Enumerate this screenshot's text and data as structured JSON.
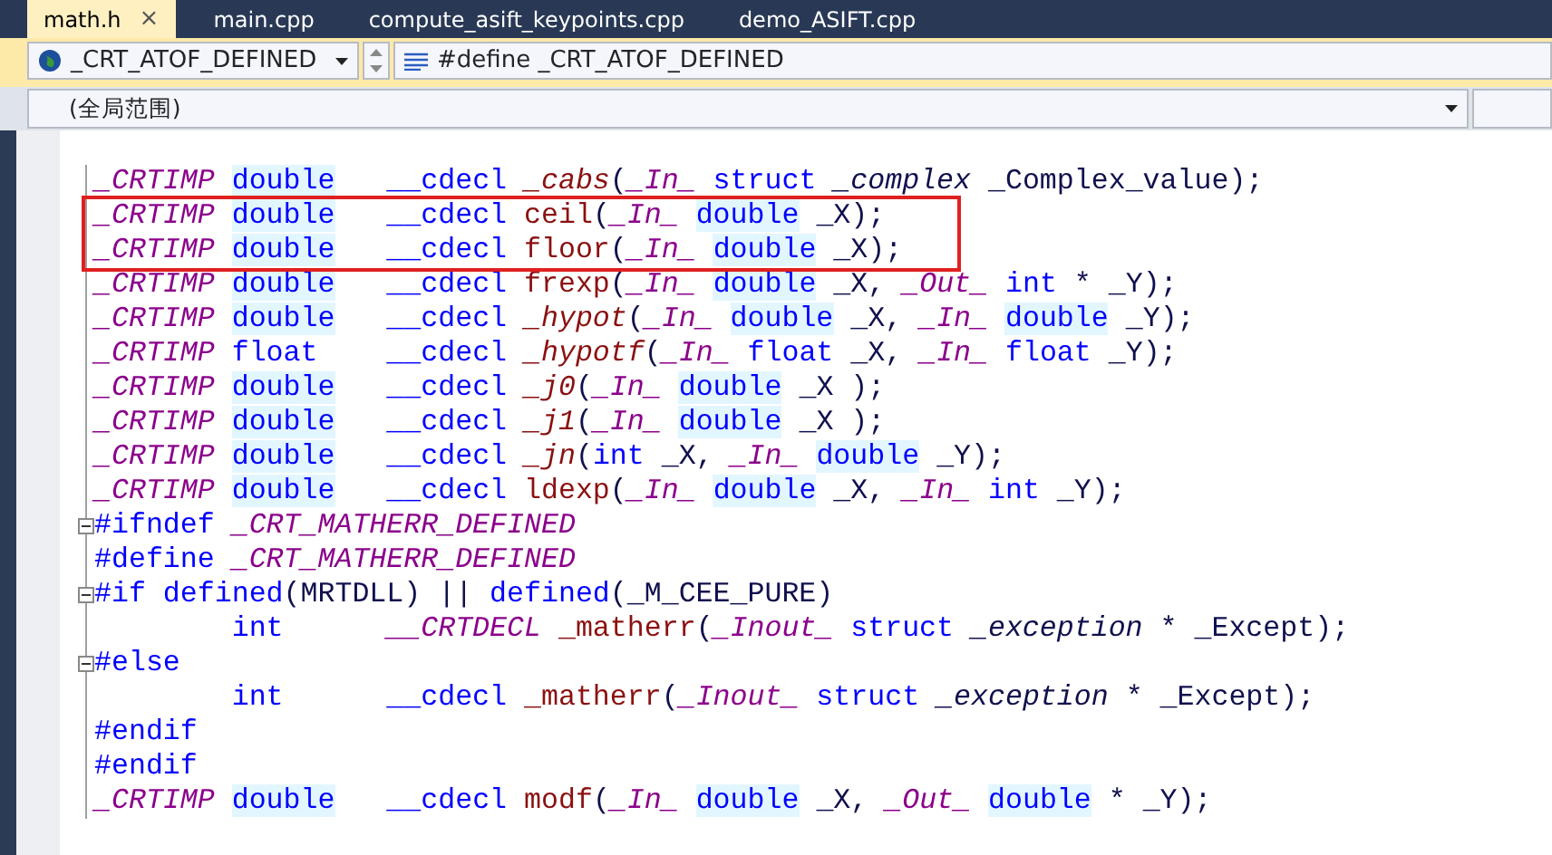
{
  "tabs": [
    {
      "label": "math.h",
      "selected": true,
      "close": "×"
    },
    {
      "label": "main.cpp",
      "selected": false
    },
    {
      "label": "compute_asift_keypoints.cpp",
      "selected": false
    },
    {
      "label": "demo_ASIFT.cpp",
      "selected": false
    }
  ],
  "navigation": {
    "type_combo": {
      "value": "_CRT_ATOF_DEFINED"
    },
    "member_combo": {
      "value": "#define _CRT_ATOF_DEFINED"
    },
    "scope_combo": {
      "value": "(全局范围)"
    }
  },
  "editor": {
    "lines": [
      {
        "tokens": [
          {
            "kind": "sal",
            "text": "_CRTIMP "
          },
          {
            "kind": "type",
            "text": "double"
          },
          {
            "kind": "kw",
            "text": "   __cdecl"
          },
          {
            "kind": "fnit",
            "text": " _cabs"
          },
          {
            "kind": "plain",
            "text": "("
          },
          {
            "kind": "sal",
            "text": "_In_"
          },
          {
            "kind": "kw",
            "text": " struct"
          },
          {
            "kind": "it",
            "text": " _complex"
          },
          {
            "kind": "plain",
            "text": " _Complex_value);"
          }
        ]
      },
      {
        "boxed": true,
        "tokens": [
          {
            "kind": "sal",
            "text": "_CRTIMP "
          },
          {
            "kind": "type",
            "text": "double"
          },
          {
            "kind": "kw",
            "text": "   __cdecl"
          },
          {
            "kind": "fn",
            "text": " ceil"
          },
          {
            "kind": "plain",
            "text": "("
          },
          {
            "kind": "sal",
            "text": "_In_ "
          },
          {
            "kind": "type",
            "text": "double"
          },
          {
            "kind": "plain",
            "text": " _X);"
          }
        ]
      },
      {
        "boxed": true,
        "tokens": [
          {
            "kind": "sal",
            "text": "_CRTIMP "
          },
          {
            "kind": "type",
            "text": "double"
          },
          {
            "kind": "kw",
            "text": "   __cdecl"
          },
          {
            "kind": "fn",
            "text": " floor"
          },
          {
            "kind": "plain",
            "text": "("
          },
          {
            "kind": "sal",
            "text": "_In_ "
          },
          {
            "kind": "type",
            "text": "double"
          },
          {
            "kind": "plain",
            "text": " _X);"
          }
        ]
      },
      {
        "tokens": [
          {
            "kind": "sal",
            "text": "_CRTIMP "
          },
          {
            "kind": "type",
            "text": "double"
          },
          {
            "kind": "kw",
            "text": "   __cdecl"
          },
          {
            "kind": "fn",
            "text": " frexp"
          },
          {
            "kind": "plain",
            "text": "("
          },
          {
            "kind": "sal",
            "text": "_In_ "
          },
          {
            "kind": "type",
            "text": "double"
          },
          {
            "kind": "plain",
            "text": " _X,"
          },
          {
            "kind": "sal",
            "text": " _Out_"
          },
          {
            "kind": "kw",
            "text": " int"
          },
          {
            "kind": "plain",
            "text": " * _Y);"
          }
        ]
      },
      {
        "tokens": [
          {
            "kind": "sal",
            "text": "_CRTIMP "
          },
          {
            "kind": "type",
            "text": "double"
          },
          {
            "kind": "kw",
            "text": "   __cdecl"
          },
          {
            "kind": "fnit",
            "text": " _hypot"
          },
          {
            "kind": "plain",
            "text": "("
          },
          {
            "kind": "sal",
            "text": "_In_ "
          },
          {
            "kind": "type",
            "text": "double"
          },
          {
            "kind": "plain",
            "text": " _X,"
          },
          {
            "kind": "sal",
            "text": " _In_ "
          },
          {
            "kind": "type",
            "text": "double"
          },
          {
            "kind": "plain",
            "text": " _Y);"
          }
        ]
      },
      {
        "tokens": [
          {
            "kind": "sal",
            "text": "_CRTIMP"
          },
          {
            "kind": "kw",
            "text": " float"
          },
          {
            "kind": "kw",
            "text": "    __cdecl"
          },
          {
            "kind": "fnit",
            "text": " _hypotf"
          },
          {
            "kind": "plain",
            "text": "("
          },
          {
            "kind": "sal",
            "text": "_In_"
          },
          {
            "kind": "kw",
            "text": " float"
          },
          {
            "kind": "plain",
            "text": " _X,"
          },
          {
            "kind": "sal",
            "text": " _In_"
          },
          {
            "kind": "kw",
            "text": " float"
          },
          {
            "kind": "plain",
            "text": " _Y);"
          }
        ]
      },
      {
        "tokens": [
          {
            "kind": "sal",
            "text": "_CRTIMP "
          },
          {
            "kind": "type",
            "text": "double"
          },
          {
            "kind": "kw",
            "text": "   __cdecl"
          },
          {
            "kind": "fnit",
            "text": " _j0"
          },
          {
            "kind": "plain",
            "text": "("
          },
          {
            "kind": "sal",
            "text": "_In_ "
          },
          {
            "kind": "type",
            "text": "double"
          },
          {
            "kind": "plain",
            "text": " _X );"
          }
        ]
      },
      {
        "tokens": [
          {
            "kind": "sal",
            "text": "_CRTIMP "
          },
          {
            "kind": "type",
            "text": "double"
          },
          {
            "kind": "kw",
            "text": "   __cdecl"
          },
          {
            "kind": "fnit",
            "text": " _j1"
          },
          {
            "kind": "plain",
            "text": "("
          },
          {
            "kind": "sal",
            "text": "_In_ "
          },
          {
            "kind": "type",
            "text": "double"
          },
          {
            "kind": "plain",
            "text": " _X );"
          }
        ]
      },
      {
        "tokens": [
          {
            "kind": "sal",
            "text": "_CRTIMP "
          },
          {
            "kind": "type",
            "text": "double"
          },
          {
            "kind": "kw",
            "text": "   __cdecl"
          },
          {
            "kind": "fnit",
            "text": " _jn"
          },
          {
            "kind": "plain",
            "text": "("
          },
          {
            "kind": "kw",
            "text": "int"
          },
          {
            "kind": "plain",
            "text": " _X,"
          },
          {
            "kind": "sal",
            "text": " _In_ "
          },
          {
            "kind": "type",
            "text": "double"
          },
          {
            "kind": "plain",
            "text": " _Y);"
          }
        ]
      },
      {
        "tokens": [
          {
            "kind": "sal",
            "text": "_CRTIMP "
          },
          {
            "kind": "type",
            "text": "double"
          },
          {
            "kind": "kw",
            "text": "   __cdecl"
          },
          {
            "kind": "fn",
            "text": " ldexp"
          },
          {
            "kind": "plain",
            "text": "("
          },
          {
            "kind": "sal",
            "text": "_In_ "
          },
          {
            "kind": "type",
            "text": "double"
          },
          {
            "kind": "plain",
            "text": " _X,"
          },
          {
            "kind": "sal",
            "text": " _In_"
          },
          {
            "kind": "kw",
            "text": " int"
          },
          {
            "kind": "plain",
            "text": " _Y);"
          }
        ]
      },
      {
        "fold_expanded": true,
        "tokens": [
          {
            "kind": "kw",
            "text": "#ifndef"
          },
          {
            "kind": "sal",
            "text": " _CRT_MATHERR_DEFINED"
          }
        ]
      },
      {
        "tokens": [
          {
            "kind": "kw",
            "text": "#define"
          },
          {
            "kind": "sal",
            "text": " _CRT_MATHERR_DEFINED"
          }
        ]
      },
      {
        "fold_expanded": true,
        "tokens": [
          {
            "kind": "kw",
            "text": "#if defined"
          },
          {
            "kind": "plain",
            "text": "(MRTDLL) ||"
          },
          {
            "kind": "kw",
            "text": " defined"
          },
          {
            "kind": "plain",
            "text": "(_M_CEE_PURE)"
          }
        ]
      },
      {
        "tokens": [
          {
            "kind": "kw",
            "text": "        int"
          },
          {
            "kind": "sal",
            "text": "      __CRTDECL"
          },
          {
            "kind": "fn",
            "text": " _matherr"
          },
          {
            "kind": "plain",
            "text": "("
          },
          {
            "kind": "sal",
            "text": "_Inout_"
          },
          {
            "kind": "kw",
            "text": " struct"
          },
          {
            "kind": "it",
            "text": " _exception"
          },
          {
            "kind": "plain",
            "text": " * _Except);"
          }
        ]
      },
      {
        "fold_expanded": true,
        "tokens": [
          {
            "kind": "kw",
            "text": "#else"
          }
        ]
      },
      {
        "tokens": [
          {
            "kind": "kw",
            "text": "        int"
          },
          {
            "kind": "kw",
            "text": "      __cdecl"
          },
          {
            "kind": "fn",
            "text": " _matherr"
          },
          {
            "kind": "plain",
            "text": "("
          },
          {
            "kind": "sal",
            "text": "_Inout_"
          },
          {
            "kind": "kw",
            "text": " struct"
          },
          {
            "kind": "it",
            "text": " _exception"
          },
          {
            "kind": "plain",
            "text": " * _Except);"
          }
        ]
      },
      {
        "tokens": [
          {
            "kind": "kw",
            "text": "#endif"
          }
        ]
      },
      {
        "tokens": [
          {
            "kind": "kw",
            "text": "#endif"
          }
        ]
      },
      {
        "tokens": [
          {
            "kind": "sal",
            "text": "_CRTIMP "
          },
          {
            "kind": "type",
            "text": "double"
          },
          {
            "kind": "kw",
            "text": "   __cdecl"
          },
          {
            "kind": "fn",
            "text": " modf"
          },
          {
            "kind": "plain",
            "text": "("
          },
          {
            "kind": "sal",
            "text": "_In_ "
          },
          {
            "kind": "type",
            "text": "double"
          },
          {
            "kind": "plain",
            "text": " _X,"
          },
          {
            "kind": "sal",
            "text": " _Out_ "
          },
          {
            "kind": "type",
            "text": "double"
          },
          {
            "kind": "plain",
            "text": " * _Y);"
          }
        ]
      }
    ]
  }
}
